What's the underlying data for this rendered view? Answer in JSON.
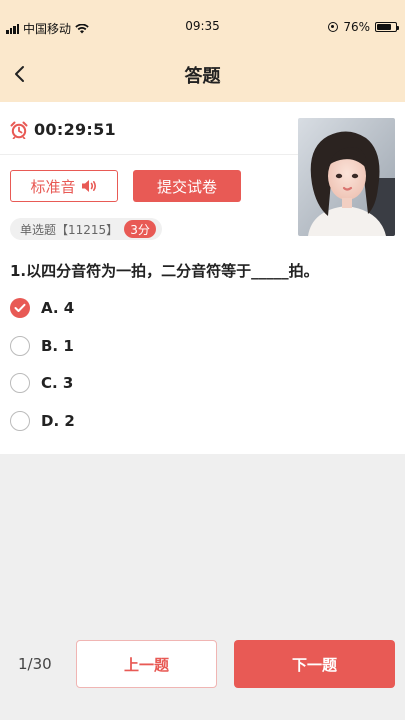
{
  "status_bar": {
    "carrier": "中国移动",
    "time": "09:35",
    "battery_percent": "76%",
    "battery_level": 0.76
  },
  "nav": {
    "title": "答题",
    "back_icon": "chevron-left-icon"
  },
  "exam": {
    "timer": "00:29:51",
    "timer_icon": "alarm-clock-icon",
    "standard_voice_label": "标准音",
    "submit_label": "提交试卷",
    "question_type": "单选题【11215】",
    "score": "3分",
    "question_text": "1.以四分音符为一拍，二分音符等于_____拍。",
    "options": [
      {
        "label": "A. 4",
        "checked": true
      },
      {
        "label": "B. 1",
        "checked": false
      },
      {
        "label": "C. 3",
        "checked": false
      },
      {
        "label": "D. 2",
        "checked": false
      }
    ]
  },
  "footer": {
    "page_indicator": "1/30",
    "prev_label": "上一题",
    "next_label": "下一题"
  },
  "colors": {
    "accent": "#e85a55",
    "header_bg": "#fbe8cc",
    "page_bg": "#efefef"
  }
}
